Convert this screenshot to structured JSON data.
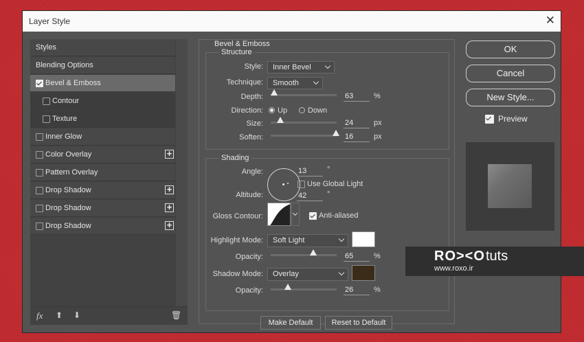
{
  "window": {
    "title": "Layer Style",
    "close": "✕"
  },
  "styles_list": [
    {
      "label": "Styles",
      "checkbox": false,
      "checked": false,
      "plus": false,
      "selected": false,
      "sub": false
    },
    {
      "label": "Blending Options",
      "checkbox": false,
      "checked": false,
      "plus": false,
      "selected": false,
      "sub": false
    },
    {
      "label": "Bevel & Emboss",
      "checkbox": true,
      "checked": true,
      "plus": false,
      "selected": true,
      "sub": false
    },
    {
      "label": "Contour",
      "checkbox": true,
      "checked": false,
      "plus": false,
      "selected": false,
      "sub": true
    },
    {
      "label": "Texture",
      "checkbox": true,
      "checked": false,
      "plus": false,
      "selected": false,
      "sub": true
    },
    {
      "label": "Inner Glow",
      "checkbox": true,
      "checked": false,
      "plus": false,
      "selected": false,
      "sub": false
    },
    {
      "label": "Color Overlay",
      "checkbox": true,
      "checked": false,
      "plus": true,
      "selected": false,
      "sub": false
    },
    {
      "label": "Pattern Overlay",
      "checkbox": true,
      "checked": false,
      "plus": false,
      "selected": false,
      "sub": false
    },
    {
      "label": "Drop Shadow",
      "checkbox": true,
      "checked": false,
      "plus": true,
      "selected": false,
      "sub": false
    },
    {
      "label": "Drop Shadow",
      "checkbox": true,
      "checked": false,
      "plus": true,
      "selected": false,
      "sub": false
    },
    {
      "label": "Drop Shadow",
      "checkbox": true,
      "checked": false,
      "plus": true,
      "selected": false,
      "sub": false
    }
  ],
  "bottom_tools": {
    "fx": "fx",
    "up": "⬆",
    "down": "⬇",
    "trash": "🗑"
  },
  "bevel": {
    "section_title": "Bevel & Emboss",
    "structure_title": "Structure",
    "style_label": "Style:",
    "style_value": "Inner Bevel",
    "technique_label": "Technique:",
    "technique_value": "Smooth",
    "depth_label": "Depth:",
    "depth_value": "63",
    "depth_unit": "%",
    "direction_label": "Direction:",
    "direction_up": "Up",
    "direction_down": "Down",
    "direction_selected": "Up",
    "size_label": "Size:",
    "size_value": "24",
    "size_unit": "px",
    "soften_label": "Soften:",
    "soften_value": "16",
    "soften_unit": "px"
  },
  "shading": {
    "title": "Shading",
    "angle_label": "Angle:",
    "angle_value": "13",
    "angle_unit": "°",
    "global_light_label": "Use Global Light",
    "global_light_checked": false,
    "altitude_label": "Altitude:",
    "altitude_value": "42",
    "altitude_unit": "°",
    "gloss_label": "Gloss Contour:",
    "anti_aliased_label": "Anti-aliased",
    "anti_aliased_checked": true,
    "highlight_mode_label": "Highlight Mode:",
    "highlight_mode_value": "Soft Light",
    "highlight_color": "#ffffff",
    "highlight_opacity_label": "Opacity:",
    "highlight_opacity_value": "65",
    "highlight_opacity_unit": "%",
    "shadow_mode_label": "Shadow Mode:",
    "shadow_mode_value": "Overlay",
    "shadow_color": "#3a2c18",
    "shadow_opacity_label": "Opacity:",
    "shadow_opacity_value": "26",
    "shadow_opacity_unit": "%"
  },
  "defaults": {
    "make_default": "Make Default",
    "reset_default": "Reset to Default"
  },
  "right": {
    "ok": "OK",
    "cancel": "Cancel",
    "new_style": "New Style...",
    "preview_label": "Preview",
    "preview_checked": true
  },
  "banner": {
    "logo": "RO><O",
    "tuts": "tuts",
    "url": "www.roxo.ir"
  }
}
